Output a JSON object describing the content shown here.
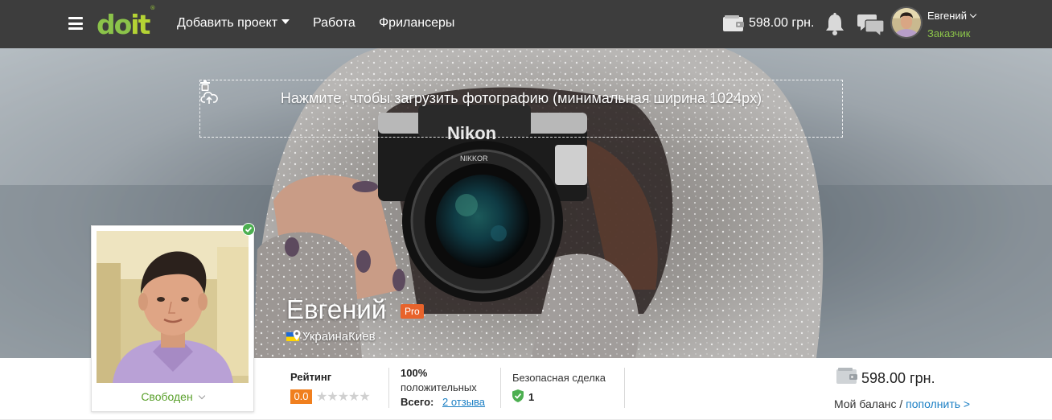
{
  "header": {
    "logo": {
      "part1": "do",
      "part2": "it",
      "mark": "®"
    },
    "nav": {
      "add_project": "Добавить проект",
      "work": "Работа",
      "freelancers": "Фрилансеры"
    },
    "balance": "598.00 грн.",
    "user": {
      "name": "Евгений",
      "role": "Заказчик"
    }
  },
  "cover": {
    "upload_hint": "Нажмите, чтобы загрузить фотографию (минимальная ширина 1024px)",
    "camera_brand": "Nikon",
    "lens_brand": "NIKKOR"
  },
  "profile": {
    "name": "Евгений",
    "badge": "Pro",
    "country": "Украина",
    "city": "Киев",
    "availability": "Свободен"
  },
  "stats": {
    "rating_label": "Рейтинг",
    "rating_value": "0.0",
    "rating_stars": "★★★★★",
    "positive_pct": "100%",
    "positive_label": "положительных",
    "total_label": "Всего:",
    "reviews_link": "2 отзыва",
    "safe_deal_label": "Безопасная сделка",
    "safe_deal_count": "1",
    "balance": "598.00 грн.",
    "balance_label": "Мой баланс",
    "separator": " / ",
    "topup_link": "пополнить >"
  },
  "colors": {
    "topbar": "#3d3d3d",
    "accent_green": "#8bc34a",
    "pro_orange": "#e8632b",
    "rating_orange": "#f07f1e",
    "link_blue": "#1b7fc4"
  },
  "icons": [
    "menu-icon",
    "wallet-icon",
    "bell-icon",
    "chat-icon",
    "cloud-upload-icon",
    "trash-icon",
    "flag-ukraine-icon",
    "map-pin-icon",
    "verified-icon",
    "shield-check-icon",
    "chevron-down-icon"
  ]
}
